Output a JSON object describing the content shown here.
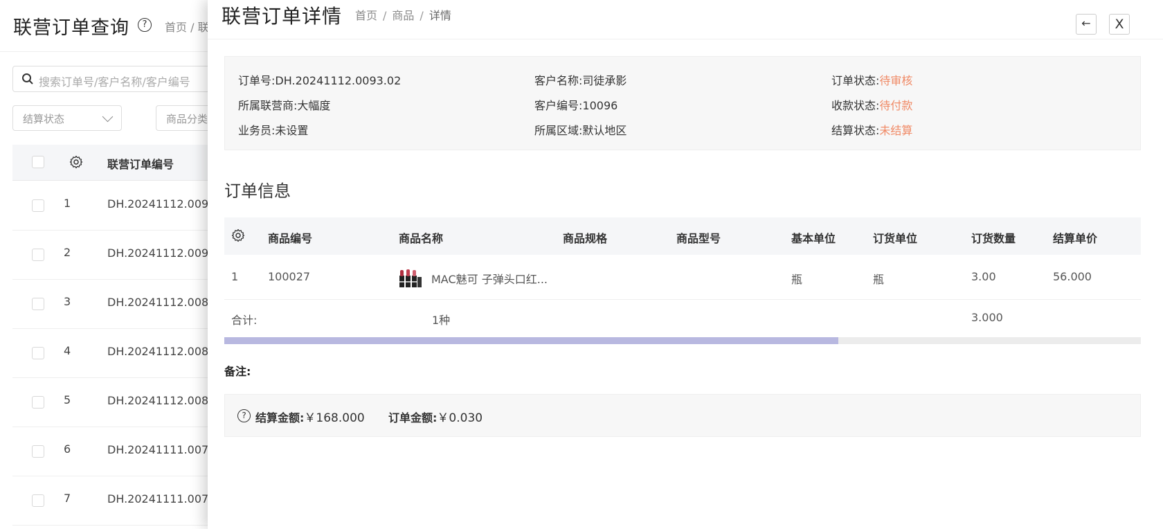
{
  "background": {
    "title": "联营订单查询",
    "help_icon": "?",
    "breadcrumb": "首页 / 联",
    "search_placeholder": "搜索订单号/客户名称/客户编号",
    "filters": [
      "结算状态",
      "商品分类"
    ],
    "table_headers": {
      "code": "联营订单编号"
    },
    "rows": [
      {
        "num": "1",
        "code": "DH.20241112.009"
      },
      {
        "num": "2",
        "code": "DH.20241112.009"
      },
      {
        "num": "3",
        "code": "DH.20241112.008"
      },
      {
        "num": "4",
        "code": "DH.20241112.008"
      },
      {
        "num": "5",
        "code": "DH.20241112.008"
      },
      {
        "num": "6",
        "code": "DH.20241111.007"
      },
      {
        "num": "7",
        "code": "DH.20241111.007"
      }
    ]
  },
  "drawer": {
    "title": "联营订单详情",
    "breadcrumb": [
      "首页",
      "商品",
      "详情"
    ],
    "breadcrumb_sep": "/",
    "back_button": "←",
    "close_button": "X",
    "info": {
      "order_no": {
        "label": "订单号:",
        "value": "DH.20241112.0093.02"
      },
      "customer_name": {
        "label": "客户名称:",
        "value": "司徒承影"
      },
      "order_status": {
        "label": "订单状态:",
        "value": "待审核"
      },
      "agent": {
        "label": "所属联营商:",
        "value": "大幅度"
      },
      "customer_no": {
        "label": "客户编号:",
        "value": "10096"
      },
      "payment_status": {
        "label": "收款状态:",
        "value": "待付款"
      },
      "salesperson": {
        "label": "业务员:",
        "value": "未设置"
      },
      "region": {
        "label": "所属区域:",
        "value": "默认地区"
      },
      "settle_status": {
        "label": "结算状态:",
        "value": "未结算"
      }
    },
    "section_title": "订单信息",
    "table": {
      "headers": [
        "商品编号",
        "商品名称",
        "商品规格",
        "商品型号",
        "基本单位",
        "订货单位",
        "订货数量",
        "结算单价"
      ],
      "rows": [
        {
          "index": "1",
          "code": "100027",
          "name": "MAC魅可 子弹头口红...",
          "spec": "",
          "model": "",
          "base_unit": "瓶",
          "order_unit": "瓶",
          "qty": "3.00",
          "price": "56.000"
        }
      ],
      "total": {
        "label": "合计:",
        "kinds": "1种",
        "qty": "3.000"
      },
      "scroll_fraction": 0.67
    },
    "remark_label": "备注:",
    "summary": {
      "settle_label": "结算金额:",
      "settle_value": "￥168.000",
      "order_label": "订单金额:",
      "order_value": "￥0.030"
    },
    "status_color": "#f08a66"
  }
}
